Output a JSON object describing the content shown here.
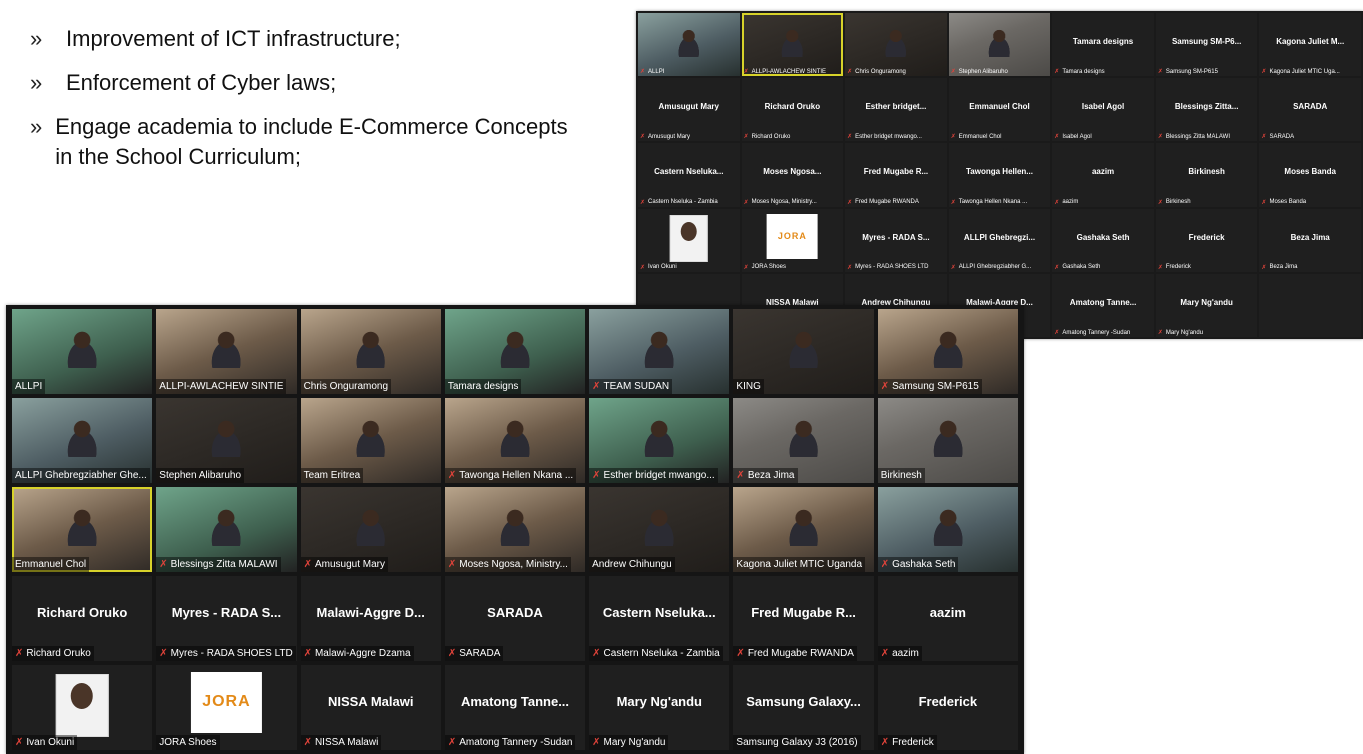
{
  "bullets": [
    {
      "mark": "»",
      "text": "Improvement of ICT infrastructure;"
    },
    {
      "mark": "»",
      "text": "Enforcement of Cyber laws;"
    },
    {
      "mark": "»",
      "text": "Engage academia to include E-Commerce Concepts in the School Curriculum;"
    }
  ],
  "window_a": {
    "tiles": [
      {
        "name": "",
        "label": "ALLPI",
        "kind": "video",
        "style": "cool",
        "muted": true
      },
      {
        "name": "",
        "label": "ALLPI-AWLACHEW SINTIE",
        "kind": "video",
        "style": "dark",
        "muted": true,
        "active": true
      },
      {
        "name": "",
        "label": "Chris Onguramong",
        "kind": "video",
        "style": "dark",
        "muted": true
      },
      {
        "name": "",
        "label": "Stephen Alibaruho",
        "kind": "video",
        "style": "stone",
        "muted": true
      },
      {
        "name": "Tamara designs",
        "label": "Tamara designs",
        "kind": "name",
        "muted": true
      },
      {
        "name": "Samsung SM-P6...",
        "label": "Samsung SM-P615",
        "kind": "name",
        "muted": true
      },
      {
        "name": "Kagona Juliet M...",
        "label": "Kagona Juliet MTIC Uga...",
        "kind": "name",
        "muted": true
      },
      {
        "name": "Amusugut Mary",
        "label": "Amusugut Mary",
        "kind": "name",
        "muted": true
      },
      {
        "name": "Richard Oruko",
        "label": "Richard Oruko",
        "kind": "name",
        "muted": true
      },
      {
        "name": "Esther bridget...",
        "label": "Esther bridget mwango...",
        "kind": "name",
        "muted": true
      },
      {
        "name": "Emmanuel Chol",
        "label": "Emmanuel Chol",
        "kind": "name",
        "muted": true
      },
      {
        "name": "Isabel Agol",
        "label": "Isabel Agol",
        "kind": "name",
        "muted": true
      },
      {
        "name": "Blessings Zitta...",
        "label": "Blessings Zitta MALAWI",
        "kind": "name",
        "muted": true
      },
      {
        "name": "SARADA",
        "label": "SARADA",
        "kind": "name",
        "muted": true
      },
      {
        "name": "Castern Nseluka...",
        "label": "Castern Nseluka - Zambia",
        "kind": "name",
        "muted": true
      },
      {
        "name": "Moses Ngosa...",
        "label": "Moses Ngosa, Ministry...",
        "kind": "name",
        "muted": true
      },
      {
        "name": "Fred Mugabe R...",
        "label": "Fred Mugabe RWANDA",
        "kind": "name",
        "muted": true
      },
      {
        "name": "Tawonga Hellen...",
        "label": "Tawonga Hellen Nkana ...",
        "kind": "name",
        "muted": true
      },
      {
        "name": "aazim",
        "label": "aazim",
        "kind": "name",
        "muted": true
      },
      {
        "name": "Birkinesh",
        "label": "Birkinesh",
        "kind": "name",
        "muted": true
      },
      {
        "name": "Moses Banda",
        "label": "Moses Banda",
        "kind": "name",
        "muted": true
      },
      {
        "name": "",
        "label": "Ivan Okuni",
        "kind": "photo",
        "muted": true
      },
      {
        "name": "",
        "label": "JORA Shoes",
        "kind": "logo",
        "logo": "JORA",
        "muted": true
      },
      {
        "name": "Myres - RADA S...",
        "label": "Myres - RADA SHOES LTD",
        "kind": "name",
        "muted": true
      },
      {
        "name": "ALLPI Ghebregzi...",
        "label": "ALLPI Ghebregziabher G...",
        "kind": "name",
        "muted": true
      },
      {
        "name": "Gashaka Seth",
        "label": "Gashaka Seth",
        "kind": "name",
        "muted": true
      },
      {
        "name": "Frederick",
        "label": "Frederick",
        "kind": "name",
        "muted": true
      },
      {
        "name": "Beza Jima",
        "label": "Beza Jima",
        "kind": "name",
        "muted": true
      },
      {
        "name": "",
        "label": "",
        "kind": "empty",
        "muted": false
      },
      {
        "name": "NISSA Malawi",
        "label": "",
        "kind": "name",
        "muted": false
      },
      {
        "name": "Andrew Chihungu",
        "label": "",
        "kind": "name",
        "muted": false
      },
      {
        "name": "Malawi-Aggre D...",
        "label": "",
        "kind": "name",
        "muted": false
      },
      {
        "name": "Amatong Tanne...",
        "label": "Amatong Tannery -Sudan",
        "kind": "name",
        "muted": true
      },
      {
        "name": "Mary Ng'andu",
        "label": "Mary Ng'andu",
        "kind": "name",
        "muted": true
      },
      {
        "name": "",
        "label": "",
        "kind": "empty",
        "muted": false
      }
    ]
  },
  "window_b": {
    "tiles": [
      {
        "name": "",
        "label": "ALLPI",
        "kind": "video",
        "style": "green",
        "muted": false
      },
      {
        "name": "",
        "label": "ALLPI-AWLACHEW SINTIE",
        "kind": "video",
        "style": "warm",
        "muted": false
      },
      {
        "name": "",
        "label": "Chris Onguramong",
        "kind": "video",
        "style": "warm",
        "muted": false
      },
      {
        "name": "",
        "label": "Tamara designs",
        "kind": "video",
        "style": "green",
        "muted": false
      },
      {
        "name": "",
        "label": "TEAM SUDAN",
        "kind": "video",
        "style": "cool",
        "muted": true
      },
      {
        "name": "",
        "label": "KING",
        "kind": "video",
        "style": "dark",
        "muted": false
      },
      {
        "name": "",
        "label": "Samsung SM-P615",
        "kind": "video",
        "style": "warm",
        "muted": true
      },
      {
        "name": "",
        "label": "ALLPI Ghebregziabher Ghe...",
        "kind": "video",
        "style": "cool",
        "muted": false
      },
      {
        "name": "",
        "label": "Stephen Alibaruho",
        "kind": "video",
        "style": "dark",
        "muted": false
      },
      {
        "name": "",
        "label": "Team Eritrea",
        "kind": "video",
        "style": "warm",
        "muted": false
      },
      {
        "name": "",
        "label": "Tawonga Hellen Nkana ...",
        "kind": "video",
        "style": "warm",
        "muted": true
      },
      {
        "name": "",
        "label": "Esther bridget mwango...",
        "kind": "video",
        "style": "green",
        "muted": true
      },
      {
        "name": "",
        "label": "Beza Jima",
        "kind": "video",
        "style": "stone",
        "muted": true
      },
      {
        "name": "",
        "label": "Birkinesh",
        "kind": "video",
        "style": "stone",
        "muted": false
      },
      {
        "name": "",
        "label": "Emmanuel Chol",
        "kind": "video",
        "style": "warm",
        "muted": false,
        "active": true
      },
      {
        "name": "",
        "label": "Blessings Zitta MALAWI",
        "kind": "video",
        "style": "green",
        "muted": true
      },
      {
        "name": "",
        "label": "Amusugut Mary",
        "kind": "video",
        "style": "dark",
        "muted": true
      },
      {
        "name": "",
        "label": "Moses Ngosa, Ministry...",
        "kind": "video",
        "style": "warm",
        "muted": true
      },
      {
        "name": "",
        "label": "Andrew Chihungu",
        "kind": "video",
        "style": "dark",
        "muted": false
      },
      {
        "name": "",
        "label": "Kagona Juliet MTIC Uganda",
        "kind": "video",
        "style": "warm",
        "muted": false
      },
      {
        "name": "",
        "label": "Gashaka Seth",
        "kind": "video",
        "style": "cool",
        "muted": true
      },
      {
        "name": "Richard Oruko",
        "label": "Richard Oruko",
        "kind": "name",
        "muted": true
      },
      {
        "name": "Myres - RADA S...",
        "label": "Myres - RADA SHOES LTD",
        "kind": "name",
        "muted": true
      },
      {
        "name": "Malawi-Aggre D...",
        "label": "Malawi-Aggre Dzama",
        "kind": "name",
        "muted": true
      },
      {
        "name": "SARADA",
        "label": "SARADA",
        "kind": "name",
        "muted": true
      },
      {
        "name": "Castern Nseluka...",
        "label": "Castern Nseluka - Zambia",
        "kind": "name",
        "muted": true
      },
      {
        "name": "Fred Mugabe R...",
        "label": "Fred Mugabe RWANDA",
        "kind": "name",
        "muted": true
      },
      {
        "name": "aazim",
        "label": "aazim",
        "kind": "name",
        "muted": true
      },
      {
        "name": "",
        "label": "Ivan Okuni",
        "kind": "photo",
        "muted": true
      },
      {
        "name": "",
        "label": "JORA Shoes",
        "kind": "logo",
        "logo": "JORA",
        "muted": false
      },
      {
        "name": "NISSA Malawi",
        "label": "NISSA Malawi",
        "kind": "name",
        "muted": true
      },
      {
        "name": "Amatong Tanne...",
        "label": "Amatong Tannery -Sudan",
        "kind": "name",
        "muted": true
      },
      {
        "name": "Mary Ng'andu",
        "label": "Mary Ng'andu",
        "kind": "name",
        "muted": true
      },
      {
        "name": "Samsung Galaxy...",
        "label": "Samsung Galaxy J3 (2016)",
        "kind": "name",
        "muted": false
      },
      {
        "name": "Frederick",
        "label": "Frederick",
        "kind": "name",
        "muted": true
      }
    ]
  },
  "icons": {
    "muted_mic": "muted-mic-icon"
  },
  "colors": {
    "active_speaker": "#d7d22a",
    "muted": "#e0433a",
    "tile_bg": "#1f1f1f"
  }
}
